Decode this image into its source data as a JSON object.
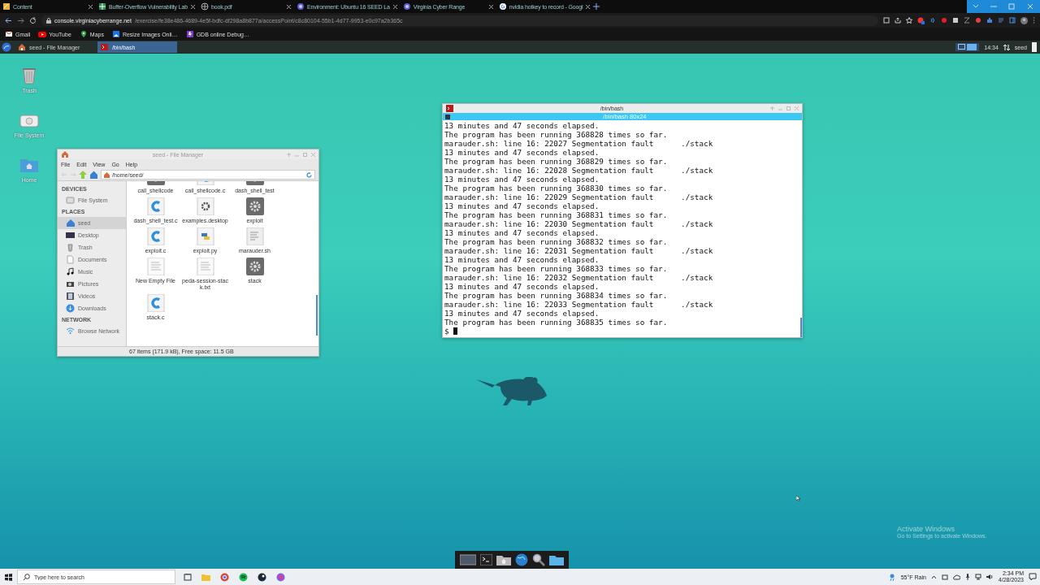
{
  "browser": {
    "tabs": [
      {
        "title": "Content",
        "kind": "doc"
      },
      {
        "title": "Buffer-Overflow Vulnerability Lab",
        "kind": "lab"
      },
      {
        "title": "book.pdf",
        "kind": "globe"
      },
      {
        "title": "Environment: Ubuntu 16 SEED La",
        "kind": "range"
      },
      {
        "title": "Virginia Cyber Range",
        "kind": "range"
      },
      {
        "title": "nvidia hotkey to record - Googl",
        "kind": "google"
      }
    ],
    "host": "console.virginiacyberrange.net",
    "path": "/exercise/fe38e486-4689-4e5f-bdfc-df298a8b877a/accessPoint/c8c80104-55b1-4d77-9953-e0c97a2b365c",
    "bookmarks": [
      {
        "label": "Gmail",
        "kind": "gmail"
      },
      {
        "label": "YouTube",
        "kind": "youtube"
      },
      {
        "label": "Maps",
        "kind": "maps"
      },
      {
        "label": "Resize Images Onli…",
        "kind": "resize"
      },
      {
        "label": "GDB online Debug…",
        "kind": "gdb"
      }
    ]
  },
  "panel": {
    "tasks": [
      {
        "title": "seed - File Manager",
        "kind": "files",
        "selected": false
      },
      {
        "title": "/bin/bash",
        "kind": "terminal",
        "selected": true
      }
    ],
    "clock": "14:34",
    "user": "seed"
  },
  "desktop_icons": [
    {
      "label": "Trash",
      "kind": "trash"
    },
    {
      "label": "File System",
      "kind": "drive"
    },
    {
      "label": "Home",
      "kind": "home"
    }
  ],
  "file_manager": {
    "title": "seed - File Manager",
    "menu": [
      "File",
      "Edit",
      "View",
      "Go",
      "Help"
    ],
    "path": "/home/seed/",
    "sidebar": [
      {
        "heading": "DEVICES",
        "items": [
          {
            "label": "File System",
            "kind": "drive",
            "selected": false
          }
        ]
      },
      {
        "heading": "PLACES",
        "items": [
          {
            "label": "seed",
            "kind": "home",
            "selected": true
          },
          {
            "label": "Desktop",
            "kind": "desktop",
            "selected": false
          },
          {
            "label": "Trash",
            "kind": "trash",
            "selected": false
          },
          {
            "label": "Documents",
            "kind": "doc",
            "selected": false
          },
          {
            "label": "Music",
            "kind": "music",
            "selected": false
          },
          {
            "label": "Pictures",
            "kind": "pictures",
            "selected": false
          },
          {
            "label": "Videos",
            "kind": "videos",
            "selected": false
          },
          {
            "label": "Downloads",
            "kind": "downloads",
            "selected": false
          }
        ]
      },
      {
        "heading": "NETWORK",
        "items": [
          {
            "label": "Browse Network",
            "kind": "network",
            "selected": false
          }
        ]
      }
    ],
    "files": [
      {
        "name": "call_shellcode",
        "kind": "exe"
      },
      {
        "name": "call_shellcode.c",
        "kind": "c"
      },
      {
        "name": "dash_shell_test",
        "kind": "exe"
      },
      {
        "name": "dash_shell_test.c",
        "kind": "c"
      },
      {
        "name": "examples.desktop",
        "kind": "desktop"
      },
      {
        "name": "exploit",
        "kind": "exe"
      },
      {
        "name": "exploit.c",
        "kind": "c"
      },
      {
        "name": "exploit.py",
        "kind": "py"
      },
      {
        "name": "marauder.sh",
        "kind": "script"
      },
      {
        "name": "New Empty File",
        "kind": "text"
      },
      {
        "name": "peda-session-stack.txt",
        "kind": "text"
      },
      {
        "name": "stack",
        "kind": "exe"
      },
      {
        "name": "stack.c",
        "kind": "c"
      }
    ],
    "status": "67 items (171.9 kB), Free space: 11.5 GB"
  },
  "terminal": {
    "title": "/bin/bash",
    "tab": "/bin/bash 80x24",
    "lines": [
      "13 minutes and 47 seconds elapsed.",
      "The program has been running 368828 times so far.",
      "marauder.sh: line 16: 22027 Segmentation fault      ./stack",
      "13 minutes and 47 seconds elapsed.",
      "The program has been running 368829 times so far.",
      "marauder.sh: line 16: 22028 Segmentation fault      ./stack",
      "13 minutes and 47 seconds elapsed.",
      "The program has been running 368830 times so far.",
      "marauder.sh: line 16: 22029 Segmentation fault      ./stack",
      "13 minutes and 47 seconds elapsed.",
      "The program has been running 368831 times so far.",
      "marauder.sh: line 16: 22030 Segmentation fault      ./stack",
      "13 minutes and 47 seconds elapsed.",
      "The program has been running 368832 times so far.",
      "marauder.sh: line 16: 22031 Segmentation fault      ./stack",
      "13 minutes and 47 seconds elapsed.",
      "The program has been running 368833 times so far.",
      "marauder.sh: line 16: 22032 Segmentation fault      ./stack",
      "13 minutes and 47 seconds elapsed.",
      "The program has been running 368834 times so far.",
      "marauder.sh: line 16: 22033 Segmentation fault      ./stack",
      "13 minutes and 47 seconds elapsed.",
      "The program has been running 368835 times so far."
    ],
    "prompt": "$"
  },
  "activation": {
    "title": "Activate Windows",
    "hint": "Go to Settings to activate Windows."
  },
  "taskbar": {
    "search_placeholder": "Type here to search",
    "weather": "55°F Rain",
    "time": "2:34 PM",
    "date": "4/28/2023"
  }
}
